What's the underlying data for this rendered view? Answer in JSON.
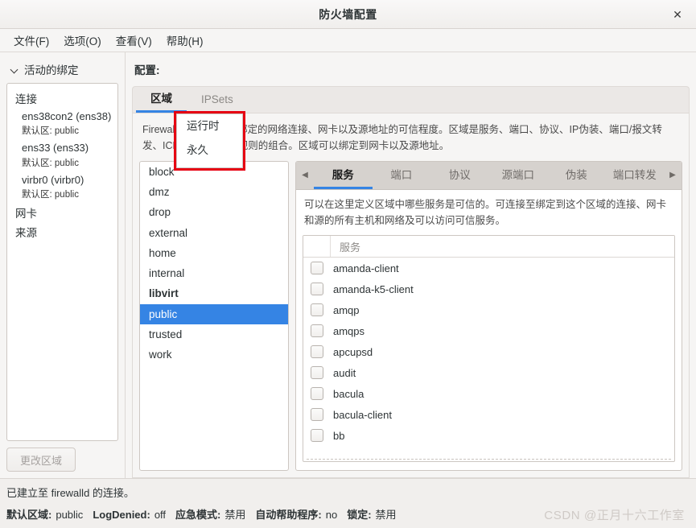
{
  "window": {
    "title": "防火墙配置",
    "close_icon": "close-icon"
  },
  "menubar": {
    "items": [
      {
        "label": "文件(F)"
      },
      {
        "label": "选项(O)"
      },
      {
        "label": "查看(V)"
      },
      {
        "label": "帮助(H)"
      }
    ]
  },
  "sidebar": {
    "header": "活动的绑定",
    "chevron_icon": "chevron-down-icon",
    "groups": [
      {
        "title": "连接",
        "entries": [
          {
            "name": "ens38con2 (ens38)",
            "sub_key": "默认区:",
            "sub_value": "public"
          },
          {
            "name": "ens33 (ens33)",
            "sub_key": "默认区:",
            "sub_value": "public"
          },
          {
            "name": "virbr0 (virbr0)",
            "sub_key": "默认区:",
            "sub_value": "public"
          }
        ]
      },
      {
        "title": "网卡",
        "entries": []
      },
      {
        "title": "来源",
        "entries": []
      }
    ],
    "change_zone_button": "更改区域"
  },
  "config": {
    "label": "配置:",
    "selected_value": "运行时",
    "dropdown_open": true,
    "options": [
      "运行时",
      "永久"
    ]
  },
  "top_tabs": [
    {
      "label": "区域",
      "active": true
    },
    {
      "label": "IPSets",
      "active": false
    }
  ],
  "zone_panel": {
    "description": "FirewallD 区域定义了绑定的网络连接、网卡以及源地址的可信程度。区域是服务、端口、协议、IP伪装、端口/报文转发、ICMP过滤以及富规则的组合。区域可以绑定到网卡以及源地址。",
    "zones": [
      {
        "name": "block",
        "bold": false,
        "selected": false
      },
      {
        "name": "dmz",
        "bold": false,
        "selected": false
      },
      {
        "name": "drop",
        "bold": false,
        "selected": false
      },
      {
        "name": "external",
        "bold": false,
        "selected": false
      },
      {
        "name": "home",
        "bold": false,
        "selected": false
      },
      {
        "name": "internal",
        "bold": false,
        "selected": false
      },
      {
        "name": "libvirt",
        "bold": true,
        "selected": false
      },
      {
        "name": "public",
        "bold": false,
        "selected": true
      },
      {
        "name": "trusted",
        "bold": false,
        "selected": false
      },
      {
        "name": "work",
        "bold": false,
        "selected": false
      }
    ]
  },
  "inner_tabs": {
    "left_arrow_icon": "chevron-left-icon",
    "right_arrow_icon": "chevron-right-icon",
    "items": [
      {
        "label": "服务",
        "active": true
      },
      {
        "label": "端口",
        "active": false
      },
      {
        "label": "协议",
        "active": false
      },
      {
        "label": "源端口",
        "active": false
      },
      {
        "label": "伪装",
        "active": false
      },
      {
        "label": "端口转发",
        "active": false
      }
    ]
  },
  "services_panel": {
    "description": "可以在这里定义区域中哪些服务是可信的。可连接至绑定到这个区域的连接、网卡和源的所有主机和网络及可以访问可信服务。",
    "column_header": "服务",
    "rows": [
      {
        "name": "amanda-client",
        "checked": false
      },
      {
        "name": "amanda-k5-client",
        "checked": false
      },
      {
        "name": "amqp",
        "checked": false
      },
      {
        "name": "amqps",
        "checked": false
      },
      {
        "name": "apcupsd",
        "checked": false
      },
      {
        "name": "audit",
        "checked": false
      },
      {
        "name": "bacula",
        "checked": false
      },
      {
        "name": "bacula-client",
        "checked": false
      },
      {
        "name": "bb",
        "checked": false
      }
    ]
  },
  "statusbar": {
    "connection_message": "已建立至 firewalld 的连接。",
    "fields": [
      {
        "key": "默认区域:",
        "value": "public"
      },
      {
        "key": "LogDenied:",
        "value": "off"
      },
      {
        "key": "应急模式:",
        "value": "禁用"
      },
      {
        "key": "自动帮助程序:",
        "value": "no"
      },
      {
        "key": "锁定:",
        "value": "禁用"
      }
    ]
  },
  "watermark": "CSDN @正月十六工作室",
  "colors": {
    "accent": "#3584e4",
    "highlight_box": "#e60012",
    "window_bg": "#f6f5f4"
  }
}
